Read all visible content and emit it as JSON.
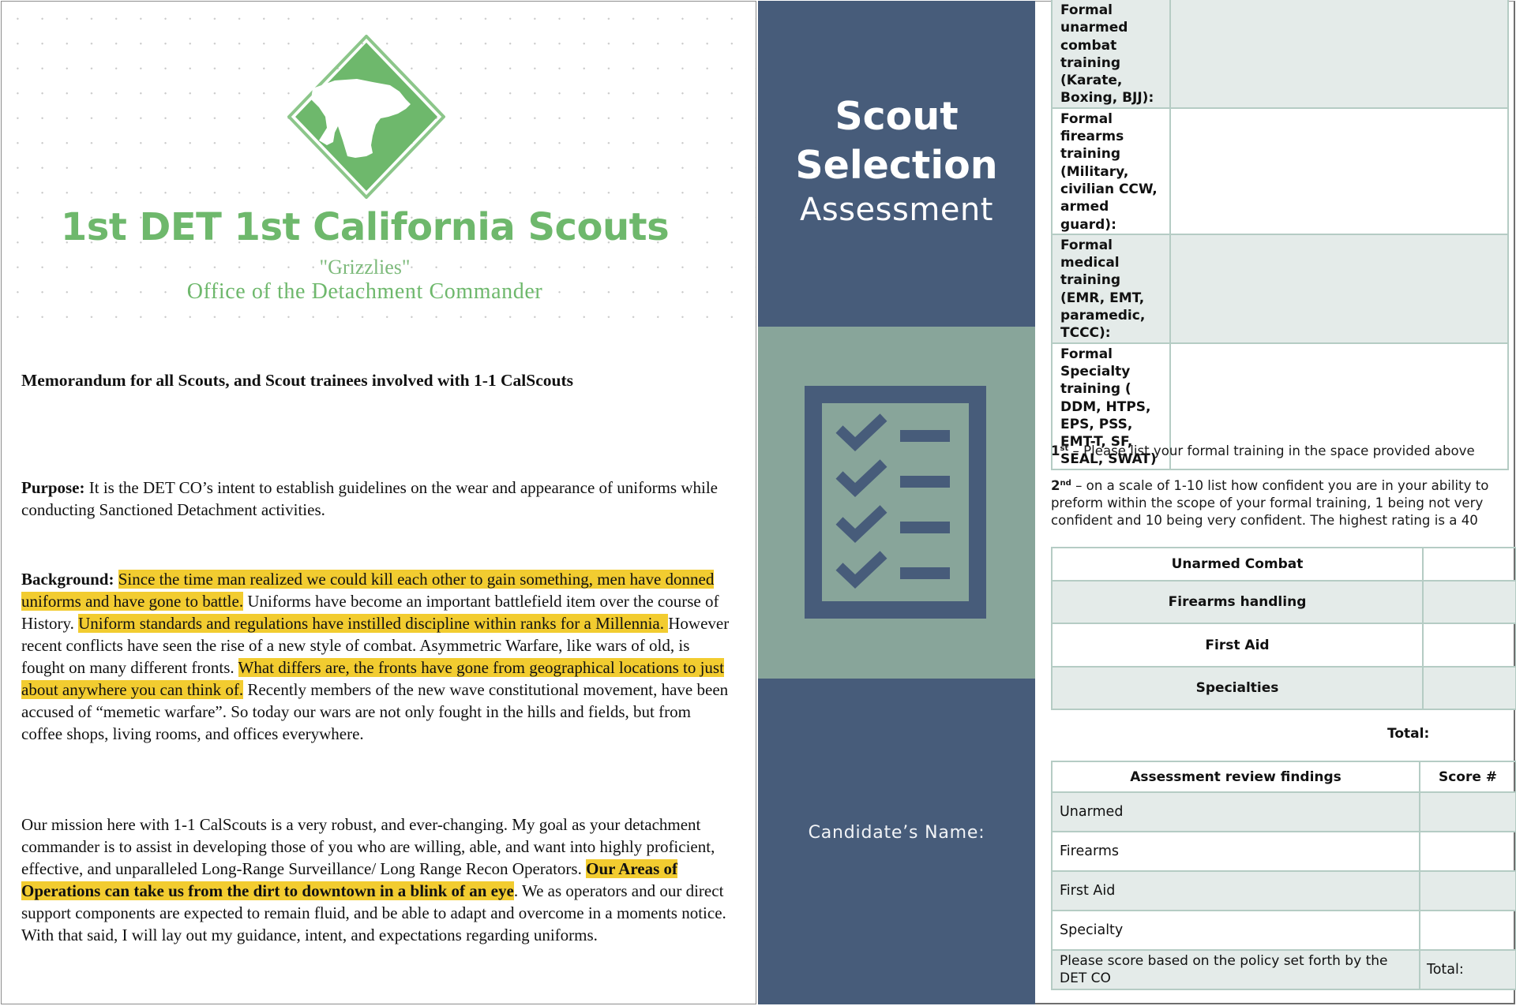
{
  "memo": {
    "letterhead": {
      "logo_icon": "grizzly-bear-diamond-logo",
      "org_name": "1st DET 1st California Scouts",
      "nickname": "\"Grizzlies\"",
      "office": "Office of the Detachment Commander"
    },
    "heading": "Memorandum for all Scouts, and Scout trainees involved with 1-1 CalScouts",
    "purpose": {
      "label": "Purpose:",
      "text": " It is the DET CO’s intent to establish guidelines on the wear and appearance of uniforms while conducting Sanctioned Detachment activities."
    },
    "background": {
      "label": "Background:",
      "hl1": "Since the time man realized we could kill each other to gain something, men have donned uniforms and have gone to battle.",
      "t1": " Uniforms have become an important battlefield item over the course of History. ",
      "hl2": "Uniform standards and regulations have instilled discipline within ranks for a Millennia. ",
      "t2": " However recent conflicts have seen the rise of a new style of combat. Asymmetric Warfare, like wars of old, is fought on many different fronts. ",
      "hl3": "What differs are, the fronts have gone from geographical locations to just about anywhere you can think of.",
      "t3": " Recently members of the new wave constitutional movement, have been accused of “memetic warfare”. So today our wars are not only fought in the hills and fields, but from coffee shops, living rooms, and offices everywhere."
    },
    "mission": {
      "t1": "Our mission here with 1-1 CalScouts is a very robust, and ever-changing. My goal as your detachment commander is to assist in developing those of you who are willing, able, and want into highly proficient, effective, and unparalleled Long-Range Surveillance/ Long Range Recon Operators. ",
      "hl_bold": "Our Areas of Operations can take us from the dirt to downtown in a blink of an eye",
      "t2": ". We as operators and our direct support components are expected to remain fluid, and be able to adapt and overcome in a moments notice. With that said, I will lay out my guidance, intent, and expectations regarding uniforms."
    },
    "highlight_color": "#f2cc30",
    "brand_green": "#6eb86c"
  },
  "cover": {
    "title_line1": "Scout",
    "title_line2": "Selection",
    "subtitle": "Assessment",
    "icon": "checklist-icon",
    "candidate_label": "Candidate’s Name:",
    "colors": {
      "navy": "#475c7a",
      "sage": "#88a59a"
    }
  },
  "form": {
    "training_rows": [
      {
        "label": "Formal unarmed combat training (Karate, Boxing, BJJ):",
        "value": ""
      },
      {
        "label": "Formal firearms training (Military, civilian CCW, armed guard):",
        "value": ""
      },
      {
        "label": "Formal medical training (EMR, EMT, paramedic, TCCC):",
        "value": ""
      },
      {
        "label": "Formal Specialty training ( DDM, HTPS, EPS, PSS, EMT-T, SF, SEAL, SWAT)",
        "value": ""
      }
    ],
    "instructions": {
      "step1_num": "1",
      "step1_sup": "st",
      "step1_text": " – Please list your formal training in the space provided above",
      "step2_num": "2",
      "step2_sup": "nd",
      "step2_text": " – on a scale of 1-10 list how confident you are in your ability to preform within the scope of your formal training, 1 being not very confident and 10 being very confident. The highest rating is a 40"
    },
    "confidence_rows": [
      {
        "category": "Unarmed Combat",
        "score": ""
      },
      {
        "category": "Firearms handling",
        "score": ""
      },
      {
        "category": "First Aid",
        "score": ""
      },
      {
        "category": "Specialties",
        "score": ""
      }
    ],
    "confidence_total_label": "Total:",
    "review": {
      "header_findings": "Assessment review findings",
      "header_score": "Score #",
      "rows": [
        {
          "finding": "Unarmed",
          "score": ""
        },
        {
          "finding": "Firearms",
          "score": ""
        },
        {
          "finding": "First Aid",
          "score": ""
        },
        {
          "finding": "Specialty",
          "score": ""
        }
      ],
      "note": "Please score based on the policy set forth by the DET CO",
      "total_label": "Total:"
    }
  }
}
